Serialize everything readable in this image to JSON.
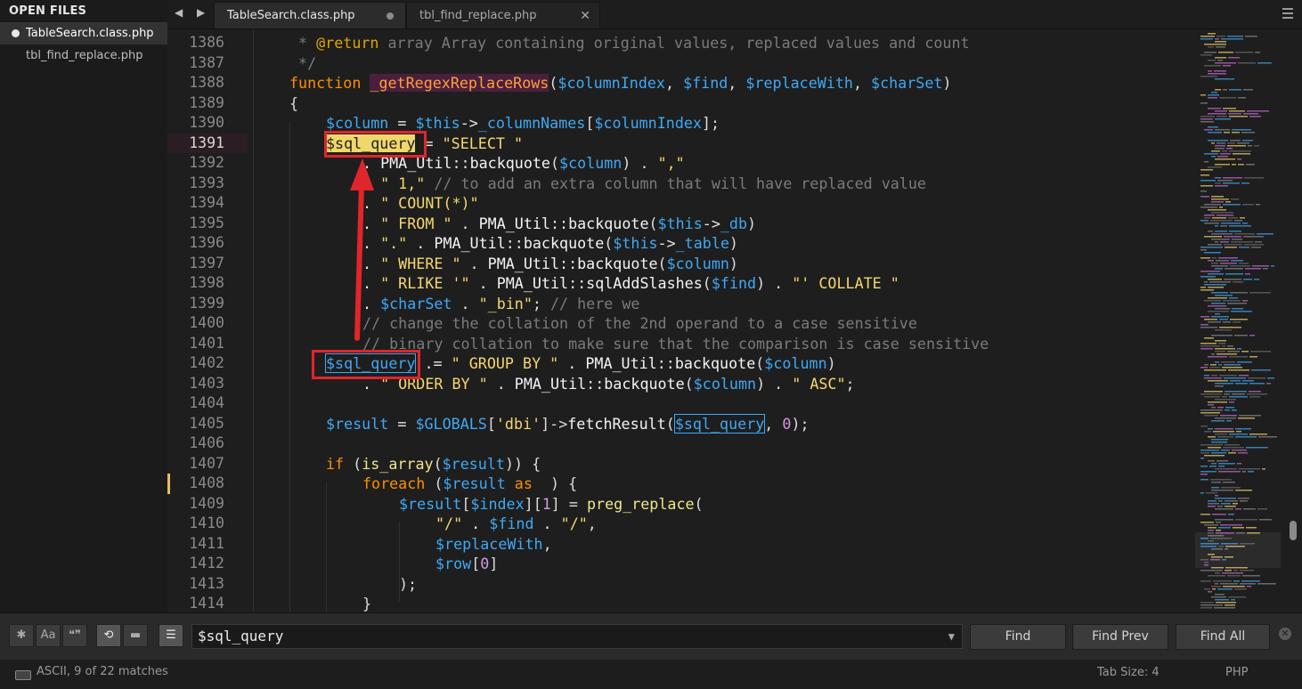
{
  "sidebar": {
    "header": "OPEN FILES",
    "files": [
      {
        "label": "TableSearch.class.php",
        "modified": true
      },
      {
        "label": "tbl_find_replace.php",
        "modified": false
      }
    ]
  },
  "tabs": [
    {
      "label": "TableSearch.class.php",
      "modified": true
    },
    {
      "label": "tbl_find_replace.php",
      "close": "✕"
    }
  ],
  "nav_arrows": "◀ ▶",
  "line_numbers": [
    "1386",
    "1387",
    "1388",
    "1389",
    "1390",
    "1391",
    "1392",
    "1393",
    "1394",
    "1395",
    "1396",
    "1397",
    "1398",
    "1399",
    "1400",
    "1401",
    "1402",
    "1403",
    "1404",
    "1405",
    "1406",
    "1407",
    "1408",
    "1409",
    "1410",
    "1411",
    "1412",
    "1413",
    "1414"
  ],
  "current_line": "1391",
  "modified_line": "1408",
  "code": {
    "l1386_a": " * ",
    "l1386_b": "@return",
    "l1386_c": " array Array containing original values, replaced values and count",
    "l1387": " */",
    "l1388_a": "function",
    "l1388_b": "_getRegexReplaceRows",
    "l1388_c": "(",
    "l1388_d": "$columnIndex",
    "l1388_e": ", ",
    "l1388_f": "$find",
    "l1388_g": ", ",
    "l1388_h": "$replaceWith",
    "l1388_i": ", ",
    "l1388_j": "$charSet",
    "l1388_k": ")",
    "l1389": "{",
    "l1390_a": "$column",
    "l1390_b": " = ",
    "l1390_c": "$this",
    "l1390_d": "->",
    "l1390_e": "_columnNames",
    "l1390_f": "[",
    "l1390_g": "$columnIndex",
    "l1390_h": "];",
    "l1391_a": "$sql_query",
    "l1391_b": " = ",
    "l1391_c": "\"SELECT \"",
    "l1392_a": ". ",
    "l1392_b": "PMA_Util",
    "l1392_c": "::",
    "l1392_d": "backquote",
    "l1392_e": "(",
    "l1392_f": "$column",
    "l1392_g": ") . ",
    "l1392_h": "\",\"",
    "l1393_a": ". ",
    "l1393_b": "\" 1,\"",
    "l1393_c": " // to add an extra column that will have replaced value",
    "l1394_a": ". ",
    "l1394_b": "\" COUNT(*)\"",
    "l1395_a": ". ",
    "l1395_b": "\" FROM \"",
    "l1395_c": " . ",
    "l1395_d": "PMA_Util",
    "l1395_e": "::",
    "l1395_f": "backquote",
    "l1395_g": "(",
    "l1395_h": "$this",
    "l1395_i": "->",
    "l1395_j": "_db",
    "l1395_k": ")",
    "l1396_a": ". ",
    "l1396_b": "\".\"",
    "l1396_c": " . ",
    "l1396_d": "PMA_Util",
    "l1396_e": "::",
    "l1396_f": "backquote",
    "l1396_g": "(",
    "l1396_h": "$this",
    "l1396_i": "->",
    "l1396_j": "_table",
    "l1396_k": ")",
    "l1397_a": ". ",
    "l1397_b": "\" WHERE \"",
    "l1397_c": " . ",
    "l1397_d": "PMA_Util",
    "l1397_e": "::",
    "l1397_f": "backquote",
    "l1397_g": "(",
    "l1397_h": "$column",
    "l1397_i": ")",
    "l1398_a": ". ",
    "l1398_b": "\" RLIKE '\"",
    "l1398_c": " . ",
    "l1398_d": "PMA_Util",
    "l1398_e": "::",
    "l1398_f": "sqlAddSlashes",
    "l1398_g": "(",
    "l1398_h": "$find",
    "l1398_i": ") . ",
    "l1398_j": "\"' COLLATE \"",
    "l1399_a": ". ",
    "l1399_b": "$charSet",
    "l1399_c": " . ",
    "l1399_d": "\"_bin\"",
    "l1399_e": "; ",
    "l1399_f": "// here we",
    "l1400": "// change the collation of the 2nd operand to a case sensitive",
    "l1401": "// binary collation to make sure that the comparison is case sensitive",
    "l1402_a": "$sql_query",
    "l1402_b": " .= ",
    "l1402_c": "\" GROUP BY \"",
    "l1402_d": " . ",
    "l1402_e": "PMA_Util",
    "l1402_f": "::",
    "l1402_g": "backquote",
    "l1402_h": "(",
    "l1402_i": "$column",
    "l1402_j": ")",
    "l1403_a": ". ",
    "l1403_b": "\" ORDER BY \"",
    "l1403_c": " . ",
    "l1403_d": "PMA_Util",
    "l1403_e": "::",
    "l1403_f": "backquote",
    "l1403_g": "(",
    "l1403_h": "$column",
    "l1403_i": ") . ",
    "l1403_j": "\" ASC\"",
    "l1403_k": ";",
    "l1405_a": "$result",
    "l1405_b": " = ",
    "l1405_c": "$GLOBALS",
    "l1405_d": "[",
    "l1405_e": "'dbi'",
    "l1405_f": "]->",
    "l1405_g": "fetchResult",
    "l1405_h": "(",
    "l1405_i": "$sql_query",
    "l1405_j": ", ",
    "l1405_k": "0",
    "l1405_l": ");",
    "l1407_a": "if",
    "l1407_b": " (",
    "l1407_c": "is_array",
    "l1407_d": "(",
    "l1407_e": "$result",
    "l1407_f": ")) {",
    "l1408_a": "foreach",
    "l1408_b": " (",
    "l1408_c": "$result",
    "l1408_d": " as",
    "l1408_e": "  ) {",
    "l1409_a": "$result",
    "l1409_b": "[",
    "l1409_c": "$index",
    "l1409_d": "][",
    "l1409_e": "1",
    "l1409_f": "] = ",
    "l1409_g": "preg_replace",
    "l1409_h": "(",
    "l1410_a": "\"/\"",
    "l1410_b": " . ",
    "l1410_c": "$find",
    "l1410_d": " . ",
    "l1410_e": "\"/\"",
    "l1410_f": ",",
    "l1411_a": "$replaceWith",
    "l1411_b": ",",
    "l1412_a": "$row",
    "l1412_b": "[",
    "l1412_c": "0",
    "l1412_d": "]",
    "l1413": ");",
    "l1414": "}"
  },
  "find_panel": {
    "toggles": [
      {
        "name": "regex-toggle",
        "glyph": "✱",
        "active": false
      },
      {
        "name": "case-toggle",
        "glyph": "Aa",
        "active": false
      },
      {
        "name": "whole-word-toggle",
        "glyph": "❝❞",
        "active": false
      },
      {
        "name": "wrap-toggle",
        "glyph": "⟲",
        "active": true
      },
      {
        "name": "in-selection-toggle",
        "glyph": "▬",
        "active": false
      },
      {
        "name": "highlight-matches-toggle",
        "glyph": "☰",
        "active": true
      }
    ],
    "query": "$sql_query",
    "find_label": "Find",
    "find_prev_label": "Find Prev",
    "find_all_label": "Find All",
    "close": "✕"
  },
  "status": {
    "left": "ASCII, 9 of 22 matches",
    "tab_size": "Tab Size: 4",
    "syntax": "PHP"
  },
  "colors": {
    "annotation": "#e0252b",
    "selection": "#f0d76c",
    "variable": "#3fa9f5",
    "string": "#f5d76e"
  }
}
